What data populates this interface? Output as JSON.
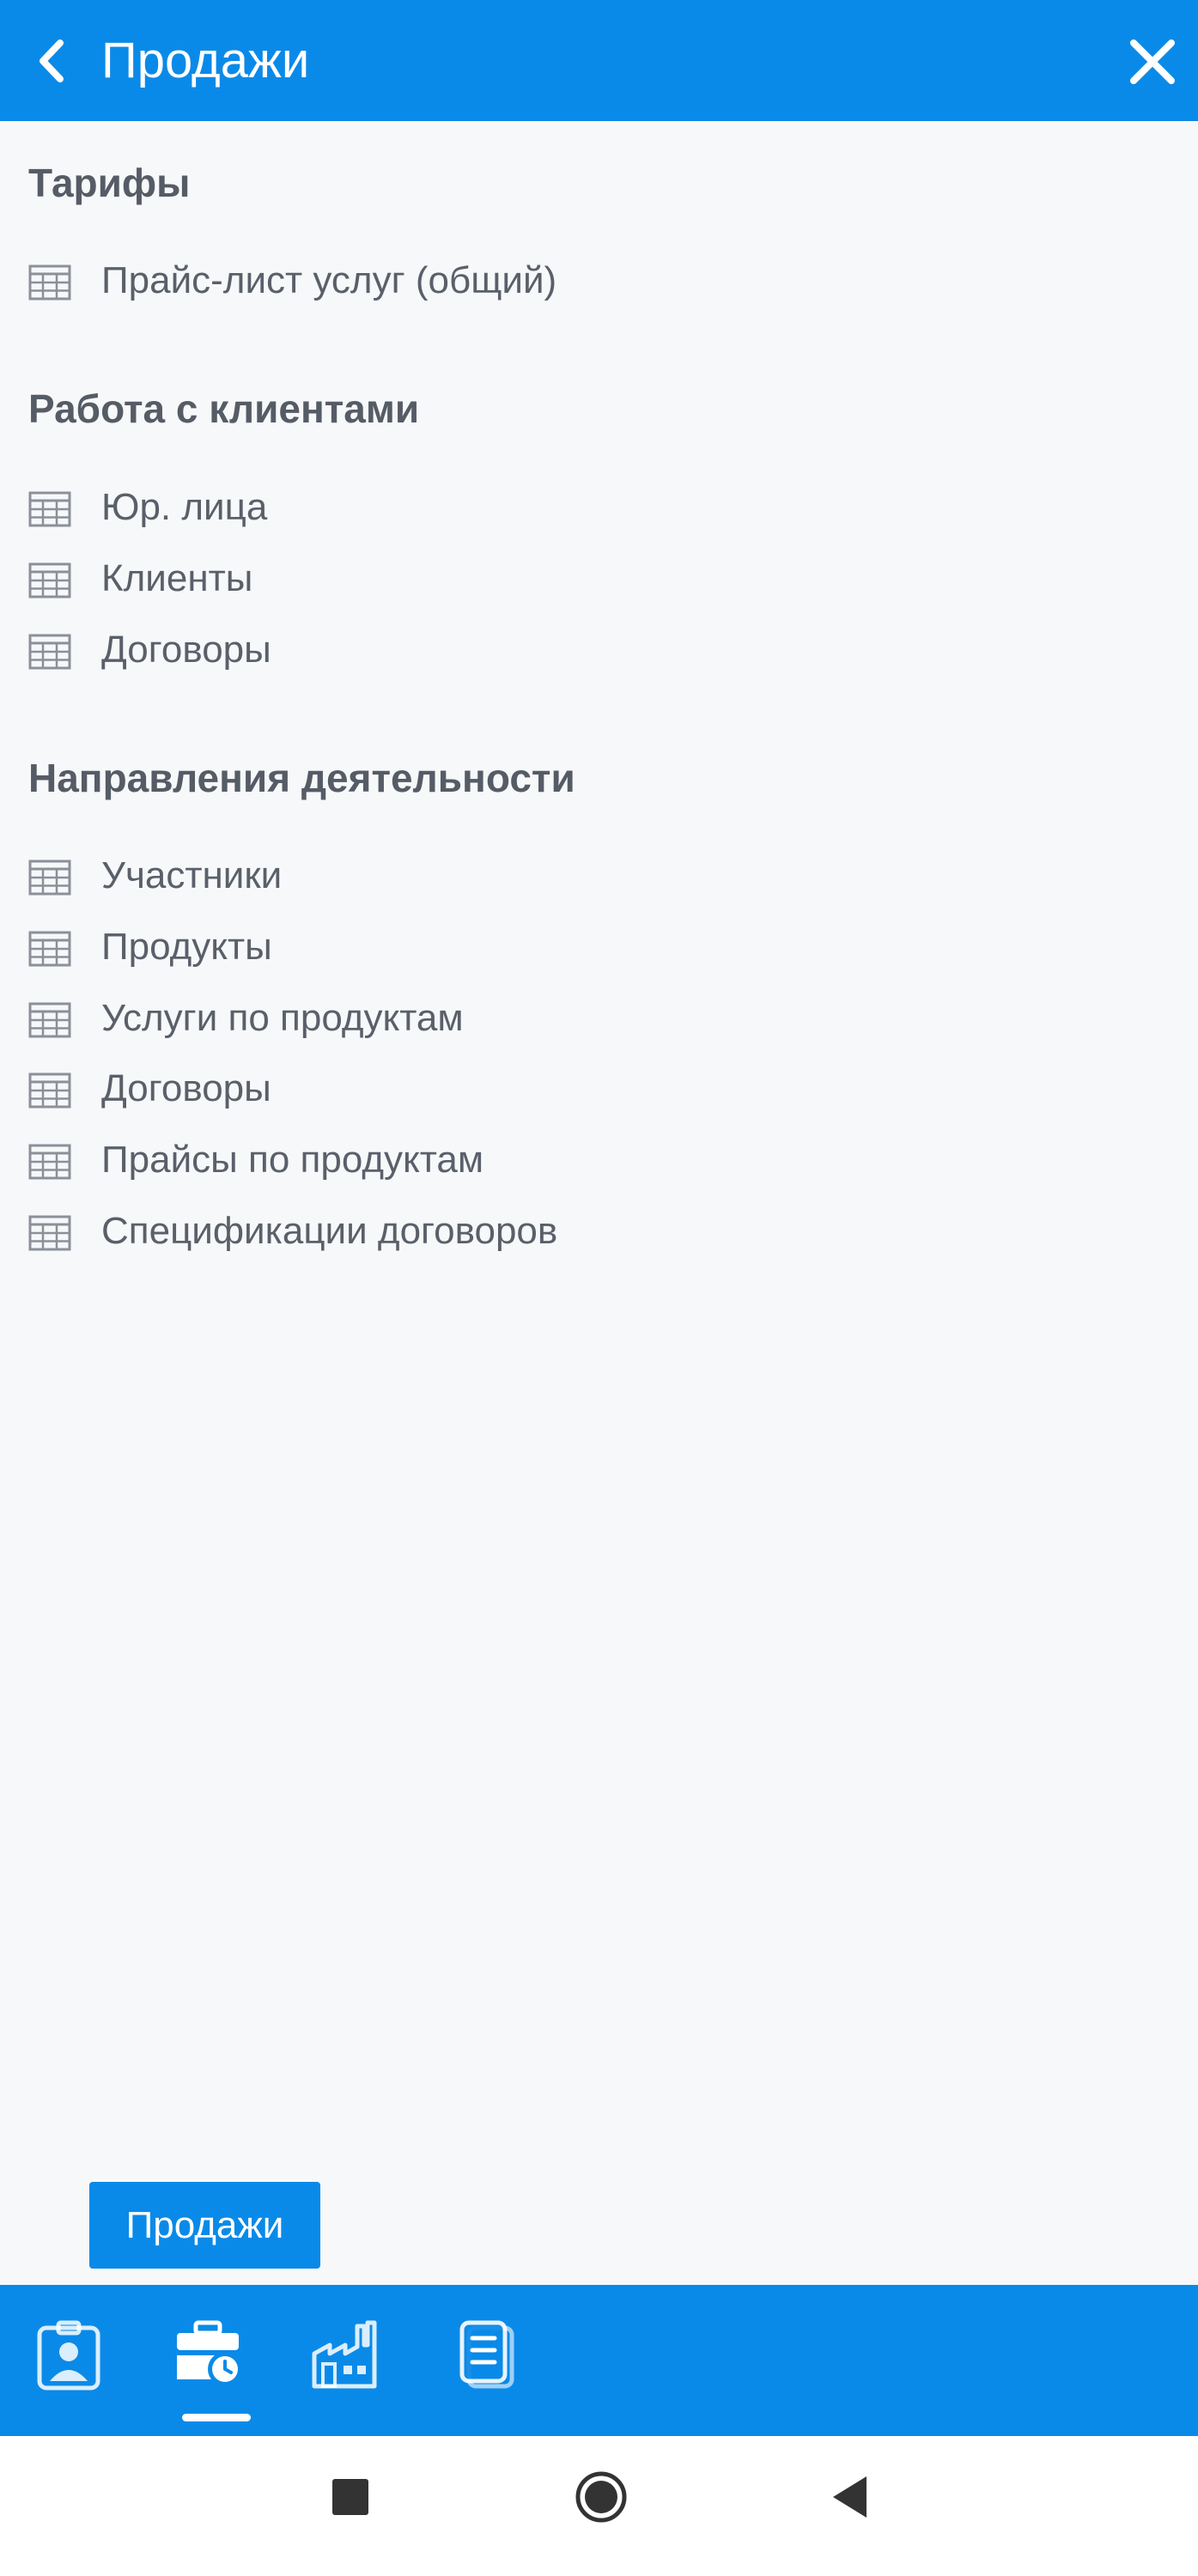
{
  "header": {
    "title": "Продажи"
  },
  "sections": [
    {
      "title": "Тарифы",
      "items": [
        "Прайс-лист услуг (общий)"
      ]
    },
    {
      "title": "Работа с клиентами",
      "items": [
        "Юр. лица",
        "Клиенты",
        "Договоры"
      ]
    },
    {
      "title": "Направления деятельности",
      "items": [
        "Участники",
        "Продукты",
        "Услуги по продуктам",
        "Договоры",
        "Прайсы по продуктам",
        "Спецификации договоров"
      ]
    }
  ],
  "bottom_button": {
    "label": "Продажи"
  },
  "tabbar": {
    "tabs": [
      {
        "icon": "user-badge-icon",
        "active": false
      },
      {
        "icon": "briefcase-clock-icon",
        "active": true
      },
      {
        "icon": "factory-icon",
        "active": false
      },
      {
        "icon": "document-icon",
        "active": false
      }
    ]
  },
  "system_nav": {
    "buttons": [
      "recents-square-icon",
      "home-circle-icon",
      "back-triangle-icon"
    ]
  },
  "colors": {
    "primary": "#0a8ae8",
    "background": "#f7f8fa",
    "text": "#5a606a",
    "heading": "#565c66"
  }
}
